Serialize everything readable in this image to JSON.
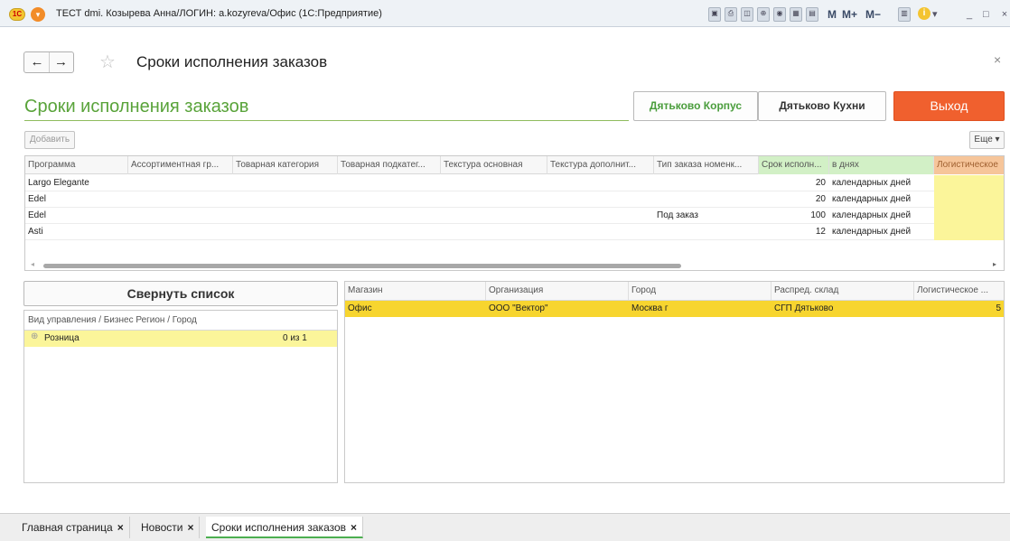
{
  "window": {
    "title": "ТЕСТ dmi. Козырева Анна/ЛОГИН: a.kozyreva/Офис  (1С:Предприятие)",
    "logo_text": "1С",
    "tool_m": "M",
    "tool_mplus": "M+",
    "tool_mminus": "M−",
    "minimize": "_",
    "maximize": "□",
    "close": "×"
  },
  "nav": {
    "back": "←",
    "forward": "→",
    "star": "☆",
    "title": "Сроки исполнения заказов",
    "close": "×"
  },
  "form": {
    "title": "Сроки исполнения заказов",
    "buttons": {
      "korpus": "Дятьково Корпус",
      "kuhni": "Дятьково Кухни",
      "exit": "Выход"
    },
    "add_label": "Добавить",
    "more_label": "Еще ▾"
  },
  "grid_top": {
    "columns": [
      "Программа",
      "Ассортиментная гр...",
      "Товарная категория",
      "Товарная подкатег...",
      "Текстура основная",
      "Текстура дополнит...",
      "Тип заказа номенк...",
      "Срок исполн...",
      "в днях",
      "Логистическое"
    ],
    "rows": [
      {
        "program": "Largo Elegante",
        "order_type": "",
        "term": "20",
        "unit": "календарных дней"
      },
      {
        "program": "Edel",
        "order_type": "",
        "term": "20",
        "unit": "календарных дней"
      },
      {
        "program": "Edel",
        "order_type": "Под заказ",
        "term": "100",
        "unit": "календарных дней"
      },
      {
        "program": "Asti",
        "order_type": "",
        "term": "12",
        "unit": "календарных дней"
      }
    ]
  },
  "collapse_label": "Свернуть список",
  "tree": {
    "header": "Вид управления / Бизнес Регион / Город",
    "expander": "⊕",
    "row_name": "Розница",
    "row_count": "0 из 1"
  },
  "grid_bottom": {
    "columns": [
      "Магазин",
      "Организация",
      "Город",
      "Распред. склад",
      "Логистическое ..."
    ],
    "row": [
      "Офис",
      "ООО \"Вектор\"",
      "Москва г",
      "СГП Дятьково",
      "5"
    ]
  },
  "tabs": [
    {
      "label": "Главная страница"
    },
    {
      "label": "Новости"
    },
    {
      "label": "Сроки исполнения заказов"
    }
  ],
  "tab_close": "×",
  "colors": {
    "accent_green": "#59a33a",
    "exit_orange": "#f0602e",
    "selected_yellow": "#f7d52f",
    "term_column_green": "#d2f0c6"
  }
}
